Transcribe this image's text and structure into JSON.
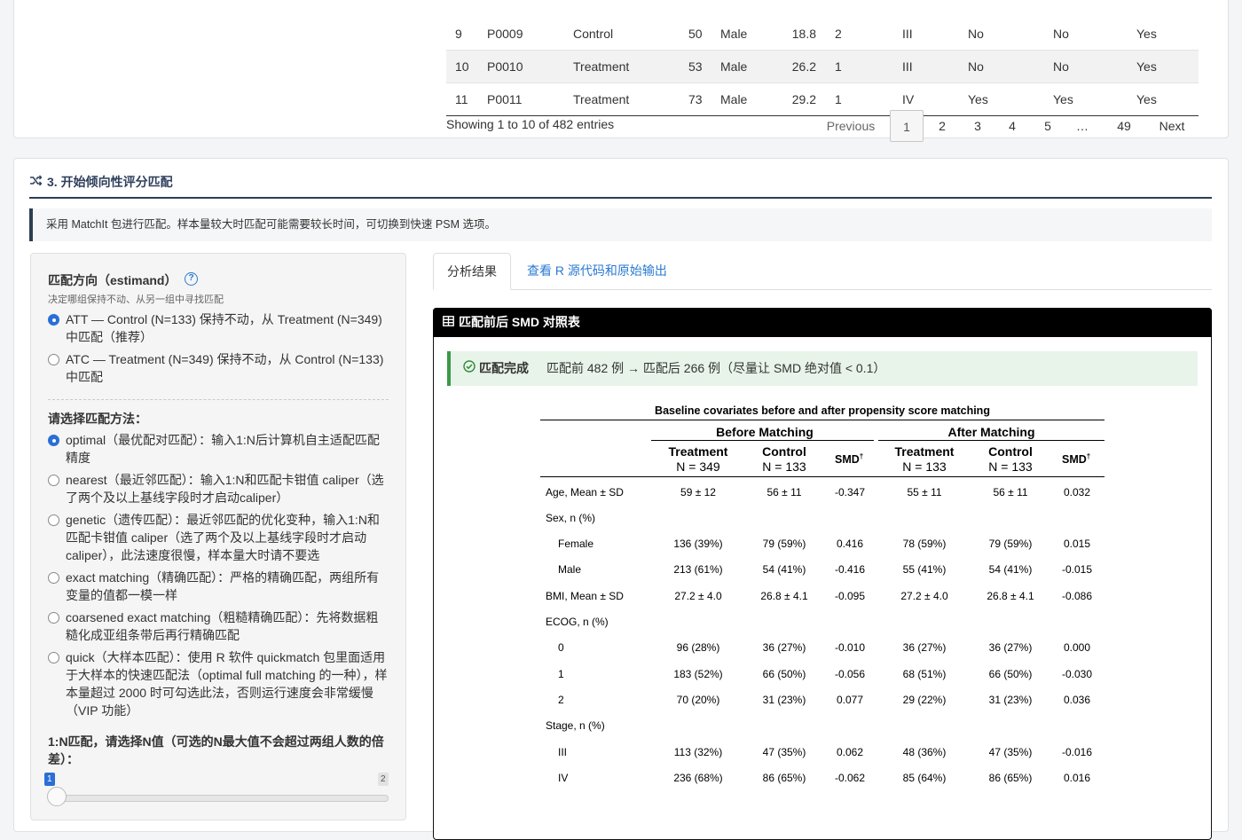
{
  "top_table": {
    "rows": [
      [
        "9",
        "P0009",
        "Control",
        "50",
        "Male",
        "18.8",
        "2",
        "III",
        "No",
        "No",
        "Yes"
      ],
      [
        "10",
        "P0010",
        "Treatment",
        "53",
        "Male",
        "26.2",
        "1",
        "III",
        "No",
        "No",
        "Yes"
      ],
      [
        "11",
        "P0011",
        "Treatment",
        "73",
        "Male",
        "29.2",
        "1",
        "IV",
        "Yes",
        "Yes",
        "Yes"
      ]
    ],
    "info": "Showing 1 to 10 of 482 entries",
    "pagination": {
      "previous": "Previous",
      "pages": [
        "1",
        "2",
        "3",
        "4",
        "5",
        "…",
        "49"
      ],
      "current": "1",
      "next": "Next"
    }
  },
  "section": {
    "title": "3. 开始倾向性评分匹配",
    "icon": "shuffle-icon",
    "note": "采用 MatchIt 包进行匹配。样本量较大时匹配可能需要较长时间，可切换到快速 PSM 选项。"
  },
  "form": {
    "estimand_label": "匹配方向（estimand）",
    "estimand_help": "?",
    "estimand_sub": "决定哪组保持不动、从另一组中寻找匹配",
    "estimand_options": [
      {
        "text": "ATT — Control (N=133) 保持不动，从 Treatment (N=349) 中匹配（推荐）",
        "selected": true
      },
      {
        "text": "ATC — Treatment (N=349) 保持不动，从 Control (N=133) 中匹配",
        "selected": false
      }
    ],
    "method_label": "请选择匹配方法：",
    "method_options": [
      {
        "text": "optimal（最优配对匹配）：输入1:N后计算机自主适配匹配精度",
        "selected": true
      },
      {
        "text": "nearest（最近邻匹配）：输入1:N和匹配卡钳值 caliper（选了两个及以上基线字段时才启动caliper）",
        "selected": false
      },
      {
        "text": "genetic（遗传匹配）：最近邻匹配的优化变种，输入1:N和匹配卡钳值 caliper（选了两个及以上基线字段时才启动caliper），此法速度很慢，样本量大时请不要选",
        "selected": false
      },
      {
        "text": "exact matching（精确匹配）：严格的精确匹配，两组所有变量的值都一模一样",
        "selected": false
      },
      {
        "text": "coarsened exact matching（粗糙精确匹配）：先将数据粗糙化成亚组条带后再行精确匹配",
        "selected": false
      },
      {
        "text": "quick（大样本匹配）：使用 R 软件 quickmatch 包里面适用于大样本的快速匹配法（optimal full matching 的一种），样本量超过 2000 时可勾选此法，否则运行速度会非常缓慢（VIP 功能）",
        "selected": false
      }
    ],
    "ratio_label": "1:N匹配，请选择N值（可选的N最大值不会超过两组人数的倍差）：",
    "slider": {
      "min": "1",
      "max": "2",
      "value": 1
    }
  },
  "tabs": {
    "active": "分析结果",
    "other": "查看 R 源代码和原始输出"
  },
  "result": {
    "header": "匹配前后 SMD 对照表",
    "header_icon": "table-icon",
    "alert_icon": "check-circle-icon",
    "alert_title": "匹配完成",
    "alert_text": "匹配前 482 例 → 匹配后 266 例（尽量让 SMD 绝对值 < 0.1）"
  },
  "smd_table": {
    "caption": "Baseline covariates before and after propensity score matching",
    "group_before": "Before Matching",
    "group_after": "After Matching",
    "columns": [
      {
        "name": "Treatment",
        "n": "N = 349"
      },
      {
        "name": "Control",
        "n": "N = 133"
      },
      {
        "name": "SMD",
        "sup": "†"
      },
      {
        "name": "Treatment",
        "n": "N = 133"
      },
      {
        "name": "Control",
        "n": "N = 133"
      },
      {
        "name": "SMD",
        "sup": "†"
      }
    ],
    "rows": [
      {
        "label": "Age, Mean ± SD",
        "indent": false,
        "cells": [
          "59 ± 12",
          "56 ± 11",
          "-0.347",
          "55 ± 11",
          "56 ± 11",
          "0.032"
        ]
      },
      {
        "label": "Sex, n (%)",
        "indent": false,
        "cells": [
          "",
          "",
          "",
          "",
          "",
          ""
        ]
      },
      {
        "label": "Female",
        "indent": true,
        "cells": [
          "136 (39%)",
          "79 (59%)",
          "0.416",
          "78 (59%)",
          "79 (59%)",
          "0.015"
        ]
      },
      {
        "label": "Male",
        "indent": true,
        "cells": [
          "213 (61%)",
          "54 (41%)",
          "-0.416",
          "55 (41%)",
          "54 (41%)",
          "-0.015"
        ]
      },
      {
        "label": "BMI, Mean ± SD",
        "indent": false,
        "cells": [
          "27.2 ± 4.0",
          "26.8 ± 4.1",
          "-0.095",
          "27.2 ± 4.0",
          "26.8 ± 4.1",
          "-0.086"
        ]
      },
      {
        "label": "ECOG, n (%)",
        "indent": false,
        "cells": [
          "",
          "",
          "",
          "",
          "",
          ""
        ]
      },
      {
        "label": "0",
        "indent": true,
        "cells": [
          "96 (28%)",
          "36 (27%)",
          "-0.010",
          "36 (27%)",
          "36 (27%)",
          "0.000"
        ]
      },
      {
        "label": "1",
        "indent": true,
        "cells": [
          "183 (52%)",
          "66 (50%)",
          "-0.056",
          "68 (51%)",
          "66 (50%)",
          "-0.030"
        ]
      },
      {
        "label": "2",
        "indent": true,
        "cells": [
          "70 (20%)",
          "31 (23%)",
          "0.077",
          "29 (22%)",
          "31 (23%)",
          "0.036"
        ]
      },
      {
        "label": "Stage, n (%)",
        "indent": false,
        "cells": [
          "",
          "",
          "",
          "",
          "",
          ""
        ]
      },
      {
        "label": "III",
        "indent": true,
        "cells": [
          "113 (32%)",
          "47 (35%)",
          "0.062",
          "48 (36%)",
          "47 (35%)",
          "-0.016"
        ]
      },
      {
        "label": "IV",
        "indent": true,
        "cells": [
          "236 (68%)",
          "86 (65%)",
          "-0.062",
          "85 (64%)",
          "86 (65%)",
          "0.016"
        ]
      }
    ]
  }
}
